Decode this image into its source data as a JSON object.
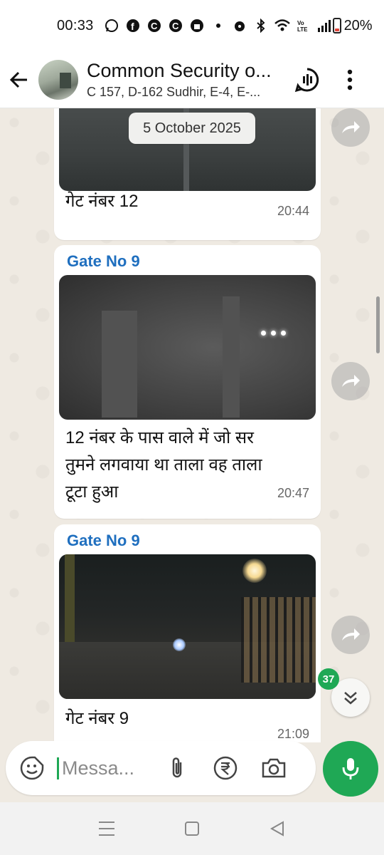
{
  "status_bar": {
    "time": "00:33",
    "battery_percent": "20%",
    "battery_level": 0.2,
    "icons": [
      "whatsapp-icon",
      "facebook-icon",
      "c-app-icon",
      "c-app-icon",
      "shopping-bag-icon",
      "dot-icon",
      "alarm-icon",
      "bluetooth-icon",
      "wifi-icon",
      "volte-icon",
      "signal-icon",
      "battery-icon"
    ]
  },
  "header": {
    "title": "Common Security o...",
    "subtitle": "C 157, D-162 Sudhir, E-4, E-..."
  },
  "date_chip": "5 October 2025",
  "messages": [
    {
      "sender": "",
      "text": "गेट नंबर 12",
      "time": "20:44"
    },
    {
      "sender": "Gate No 9",
      "text": "12 नंबर के पास वाले में जो सर तुमने लगवाया था ताला वह ताला टूटा हुआ",
      "time": "20:47"
    },
    {
      "sender": "Gate No 9",
      "text": "गेट नंबर 9",
      "time": "21:09"
    }
  ],
  "unread_count": "37",
  "composer": {
    "placeholder": "Messa..."
  },
  "colors": {
    "accent": "#1fa855",
    "sender": "#1f6fbf",
    "chat_bg": "#efeae2"
  }
}
